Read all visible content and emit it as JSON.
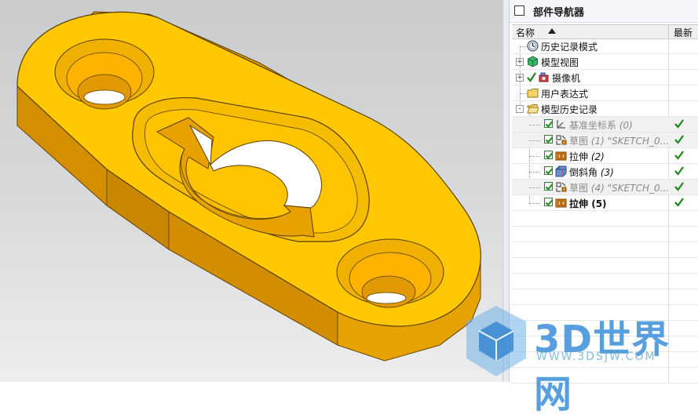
{
  "navigator": {
    "title": "部件导航器",
    "columns": {
      "name": "名称",
      "latest": "最新"
    }
  },
  "tree": [
    {
      "label": "历史记录模式",
      "icon": "clock-icon",
      "style": "normal",
      "expand": "",
      "latest": false
    },
    {
      "label": "模型视图",
      "icon": "model-view-icon",
      "style": "normal",
      "expand": "+",
      "latest": false
    },
    {
      "label": "摄像机",
      "icon": "camera-icon",
      "style": "normal",
      "expand": "+",
      "latest": false
    },
    {
      "label": "用户表达式",
      "icon": "folder-icon",
      "style": "normal",
      "expand": "",
      "latest": false
    },
    {
      "label": "模型历史记录",
      "icon": "folder-open-icon",
      "style": "normal",
      "expand": "-",
      "latest": false
    },
    {
      "label": "基准坐标系",
      "suffix": "(0)",
      "icon": "datum-csys-icon",
      "style": "gray",
      "latest": true
    },
    {
      "label": "草图",
      "suffix": "(1) \"SKETCH_0...",
      "icon": "sketch-icon",
      "style": "gray",
      "latest": true
    },
    {
      "label": "拉伸",
      "suffix": "(2)",
      "icon": "extrude-icon",
      "style": "normal",
      "latest": true
    },
    {
      "label": "倒斜角",
      "suffix": "(3)",
      "icon": "chamfer-icon",
      "style": "normal",
      "latest": true
    },
    {
      "label": "草图",
      "suffix": "(4) \"SKETCH_0...",
      "icon": "sketch-icon",
      "style": "gray",
      "latest": true
    },
    {
      "label": "拉伸",
      "suffix": "(5)",
      "icon": "extrude-icon",
      "style": "bold",
      "latest": true
    }
  ],
  "colors": {
    "part": "#ffc800",
    "part_side": "#e8a200",
    "check": "#1b8a1b",
    "watermark": "#3a8fd9"
  },
  "watermark": {
    "brand": "3D世界网",
    "url": "WWW.3DSJW.COM"
  }
}
